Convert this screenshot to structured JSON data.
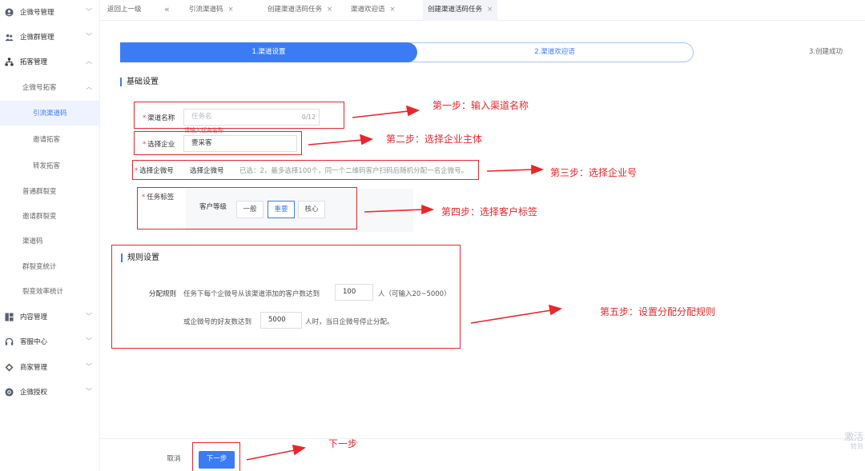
{
  "sidebar": {
    "items": [
      {
        "label": "企微号管理",
        "icon": "user-circle-icon",
        "expanded": false
      },
      {
        "label": "企微群管理",
        "icon": "group-icon",
        "expanded": false
      },
      {
        "label": "拓客管理",
        "icon": "hierarchy-icon",
        "expanded": true
      },
      {
        "label": "企微号拓客",
        "sub": true,
        "expanded": true
      },
      {
        "label": "引流渠道码",
        "sub2": true,
        "active": true
      },
      {
        "label": "邀请拓客",
        "sub2": true
      },
      {
        "label": "转发拓客",
        "sub2": true
      },
      {
        "label": "普通群裂变",
        "sub": true
      },
      {
        "label": "邀请群裂变",
        "sub": true
      },
      {
        "label": "渠道码",
        "sub": true
      },
      {
        "label": "群裂变统计",
        "sub": true
      },
      {
        "label": "裂变效率统计",
        "sub": true
      },
      {
        "label": "内容管理",
        "icon": "grid-icon",
        "expanded": false
      },
      {
        "label": "客服中心",
        "icon": "headset-icon",
        "expanded": false
      },
      {
        "label": "商家管理",
        "icon": "diamond-icon",
        "expanded": false
      },
      {
        "label": "企微授权",
        "icon": "at-icon",
        "expanded": false
      }
    ]
  },
  "tabs": {
    "back": "返回上一级",
    "items": [
      {
        "label": "引流渠道码"
      },
      {
        "label": "创建渠道活码任务"
      },
      {
        "label": "渠道欢迎语"
      },
      {
        "label": "创建渠道活码任务",
        "active": true
      }
    ]
  },
  "steps": [
    "1.渠道设置",
    "2.渠道欢迎语",
    "3.创建成功"
  ],
  "basic": {
    "title": "基础设置",
    "channel_name_label": "渠道名称",
    "channel_name_placeholder": "任务名",
    "channel_name_counter": "0/12",
    "channel_name_error": "请输入任务名称",
    "company_label": "选择企业",
    "company_value": "壹采客",
    "wecom_label": "选择企微号",
    "wecom_select": "选择企微号",
    "wecom_hint": "已选：2，最多选择100个，同一个二维码客户扫码后随机分配一名企微号。",
    "tag_label": "任务标签",
    "tag_group": "客户等级",
    "tag_options": [
      "一般",
      "重要",
      "核心"
    ],
    "tag_selected": "重要"
  },
  "rules": {
    "title": "规则设置",
    "label": "分配规则",
    "line1_prefix": "任务下每个企微号从该渠道添加的客户数达到",
    "line1_value": "100",
    "line1_suffix": "人（可输入20~5000）",
    "line2_prefix": "或企微号的好友数达到",
    "line2_value": "5000",
    "line2_suffix": "人时，当日企微号停止分配。"
  },
  "footer": {
    "cancel": "取消",
    "next": "下一步"
  },
  "annotations": {
    "step1": "第一步：输入渠道名称",
    "step2": "第二步：选择企业主体",
    "step3": "第三步：选择企业号",
    "step4": "第四步：选择客户标签",
    "step5": "第五步：设置分配分配规则",
    "next": "下一步",
    "color": "#e8262b"
  },
  "watermark": [
    "激活",
    "转到"
  ]
}
